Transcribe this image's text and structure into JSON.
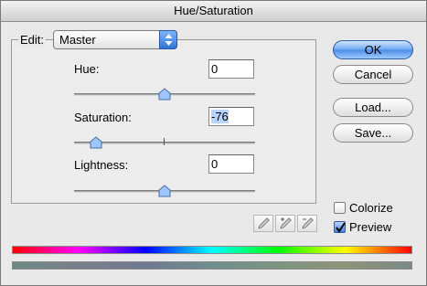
{
  "window": {
    "title": "Hue/Saturation"
  },
  "edit": {
    "label": "Edit:",
    "value": "Master"
  },
  "hue": {
    "label": "Hue:",
    "value": "0",
    "slider_fraction": 0.5
  },
  "saturation": {
    "label": "Saturation:",
    "value": "-76",
    "slider_fraction": 0.12
  },
  "lightness": {
    "label": "Lightness:",
    "value": "0",
    "slider_fraction": 0.5
  },
  "buttons": {
    "ok": "OK",
    "cancel": "Cancel",
    "load": "Load...",
    "save": "Save..."
  },
  "checkboxes": {
    "colorize": {
      "label": "Colorize",
      "checked": false
    },
    "preview": {
      "label": "Preview",
      "checked": true
    }
  },
  "icons": [
    "eyedropper-icon",
    "eyedropper-plus-icon",
    "eyedropper-minus-icon"
  ],
  "colors": {
    "default_button": "#5a97ea",
    "selection": "#b5d5ff"
  }
}
